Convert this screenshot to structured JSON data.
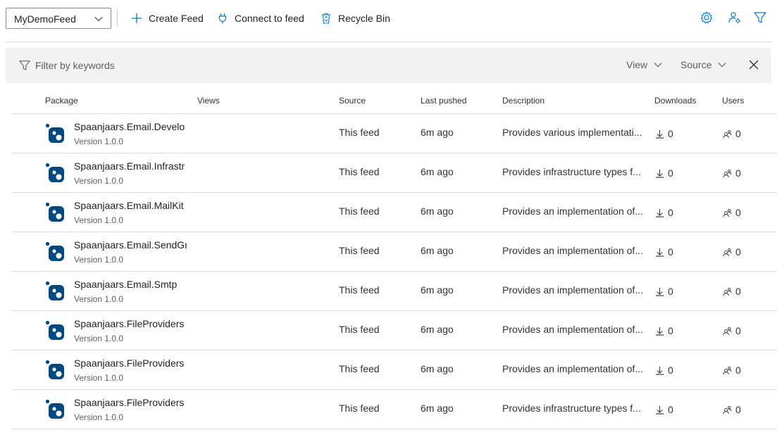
{
  "toolbar": {
    "feed_selector": {
      "value": "MyDemoFeed"
    },
    "create_feed": "Create Feed",
    "connect_feed": "Connect to feed",
    "recycle_bin": "Recycle Bin"
  },
  "filter": {
    "placeholder": "Filter by keywords",
    "view_label": "View",
    "source_label": "Source"
  },
  "columns": {
    "package": "Package",
    "views": "Views",
    "source": "Source",
    "last_pushed": "Last pushed",
    "description": "Description",
    "downloads": "Downloads",
    "users": "Users"
  },
  "colors": {
    "accent": "#0078d4",
    "package_icon": "#004880"
  },
  "packages": [
    {
      "name": "Spaanjaars.Email.Develo",
      "version": "Version 1.0.0",
      "source": "This feed",
      "last_pushed": "6m ago",
      "description": "Provides various implementati...",
      "downloads": "0",
      "users": "0"
    },
    {
      "name": "Spaanjaars.Email.Infrastr",
      "version": "Version 1.0.0",
      "source": "This feed",
      "last_pushed": "6m ago",
      "description": "Provides infrastructure types f...",
      "downloads": "0",
      "users": "0"
    },
    {
      "name": "Spaanjaars.Email.MailKit",
      "version": "Version 1.0.0",
      "source": "This feed",
      "last_pushed": "6m ago",
      "description": "Provides an implementation of...",
      "downloads": "0",
      "users": "0"
    },
    {
      "name": "Spaanjaars.Email.SendGr",
      "version": "Version 1.0.0",
      "source": "This feed",
      "last_pushed": "6m ago",
      "description": "Provides an implementation of...",
      "downloads": "0",
      "users": "0"
    },
    {
      "name": "Spaanjaars.Email.Smtp",
      "version": "Version 1.0.0",
      "source": "This feed",
      "last_pushed": "6m ago",
      "description": "Provides an implementation of...",
      "downloads": "0",
      "users": "0"
    },
    {
      "name": "Spaanjaars.FileProviders",
      "version": "Version 1.0.0",
      "source": "This feed",
      "last_pushed": "6m ago",
      "description": "Provides an implementation of...",
      "downloads": "0",
      "users": "0"
    },
    {
      "name": "Spaanjaars.FileProviders",
      "version": "Version 1.0.0",
      "source": "This feed",
      "last_pushed": "6m ago",
      "description": "Provides an implementation of...",
      "downloads": "0",
      "users": "0"
    },
    {
      "name": "Spaanjaars.FileProviders",
      "version": "Version 1.0.0",
      "source": "This feed",
      "last_pushed": "6m ago",
      "description": "Provides infrastructure types f...",
      "downloads": "0",
      "users": "0"
    }
  ]
}
